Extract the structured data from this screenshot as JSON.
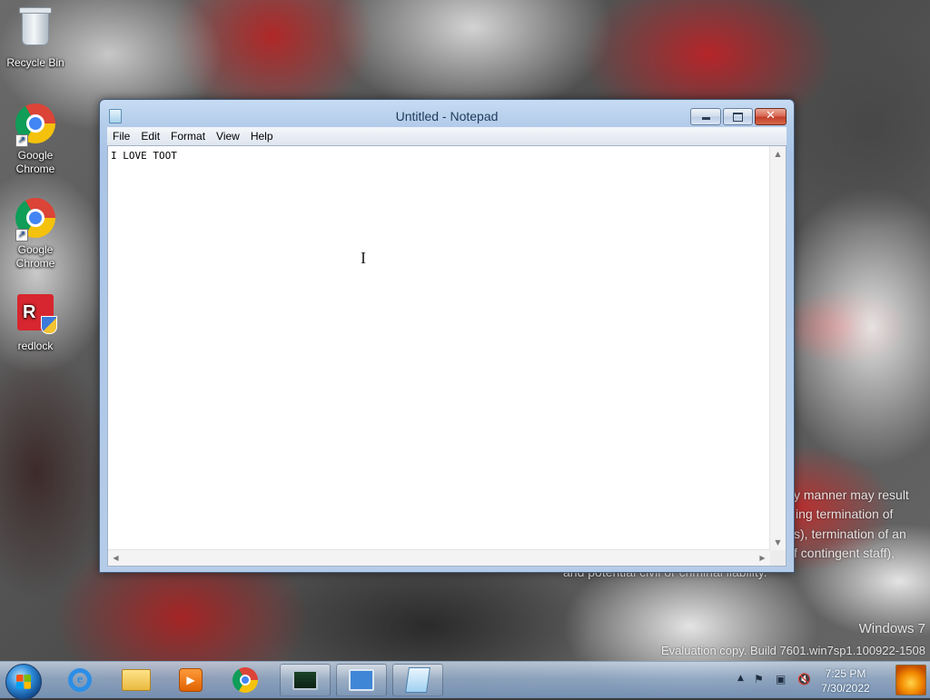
{
  "desktop": {
    "icons": [
      {
        "label": "Recycle Bin",
        "icon": "recycle-bin-icon"
      },
      {
        "label": "Google Chrome",
        "icon": "chrome-icon"
      },
      {
        "label": "Google Chrome",
        "icon": "chrome-icon"
      },
      {
        "label": "redlock",
        "icon": "redlock-icon"
      }
    ],
    "watermark": {
      "lines": [
        "y manner may result",
        "ing termination of",
        "s), termination of an",
        "f contingent staff),",
        "and potential civil or criminal liability."
      ],
      "os_name": "Windows 7",
      "build": "Evaluation copy. Build 7601.win7sp1.100922-1508"
    }
  },
  "notepad": {
    "title": "Untitled - Notepad",
    "menu": [
      "File",
      "Edit",
      "Format",
      "View",
      "Help"
    ],
    "content": "I LOVE TOOT",
    "controls": {
      "minimize": "minimize",
      "maximize": "maximize",
      "close": "close"
    }
  },
  "taskbar": {
    "pinned": [
      {
        "name": "start-button"
      },
      {
        "name": "internet-explorer-icon"
      },
      {
        "name": "windows-explorer-icon"
      },
      {
        "name": "windows-media-player-icon"
      },
      {
        "name": "google-chrome-icon"
      },
      {
        "name": "task-manager-icon"
      },
      {
        "name": "remote-desktop-icon"
      },
      {
        "name": "notepad-icon"
      }
    ],
    "tray": {
      "time": "7:25 PM",
      "date": "7/30/2022"
    }
  },
  "colors": {
    "title_text": "#1e395b",
    "close_button": "#c23d28",
    "taskbar": "#96afcd"
  }
}
